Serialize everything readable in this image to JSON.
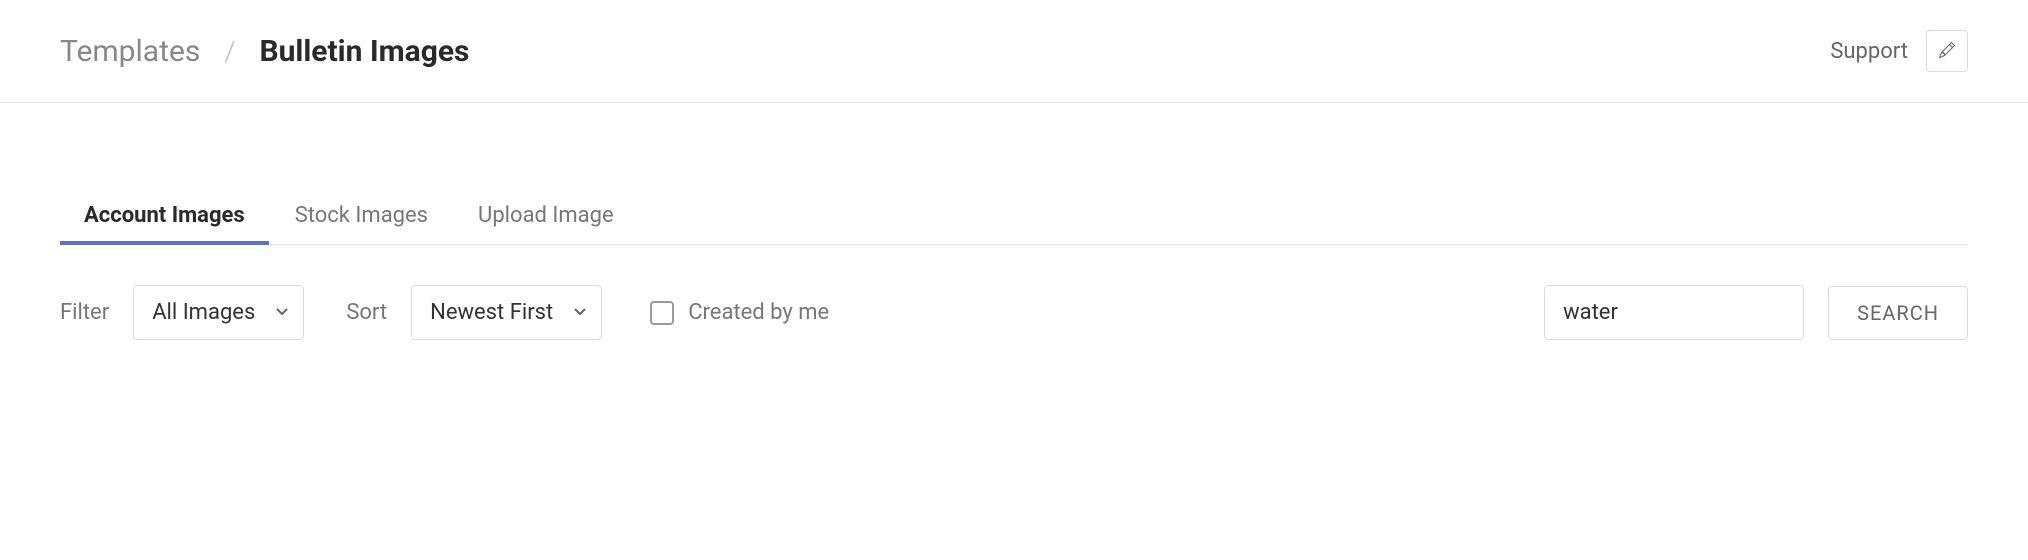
{
  "breadcrumb": {
    "parent": "Templates",
    "separator": "/",
    "current": "Bulletin Images"
  },
  "header": {
    "support_label": "Support"
  },
  "tabs": [
    {
      "label": "Account Images",
      "active": true
    },
    {
      "label": "Stock Images",
      "active": false
    },
    {
      "label": "Upload Image",
      "active": false
    }
  ],
  "filter": {
    "filter_label": "Filter",
    "filter_value": "All Images",
    "sort_label": "Sort",
    "sort_value": "Newest First",
    "created_by_me_label": "Created by me",
    "created_by_me_checked": false,
    "search_value": "water",
    "search_button": "SEARCH"
  }
}
